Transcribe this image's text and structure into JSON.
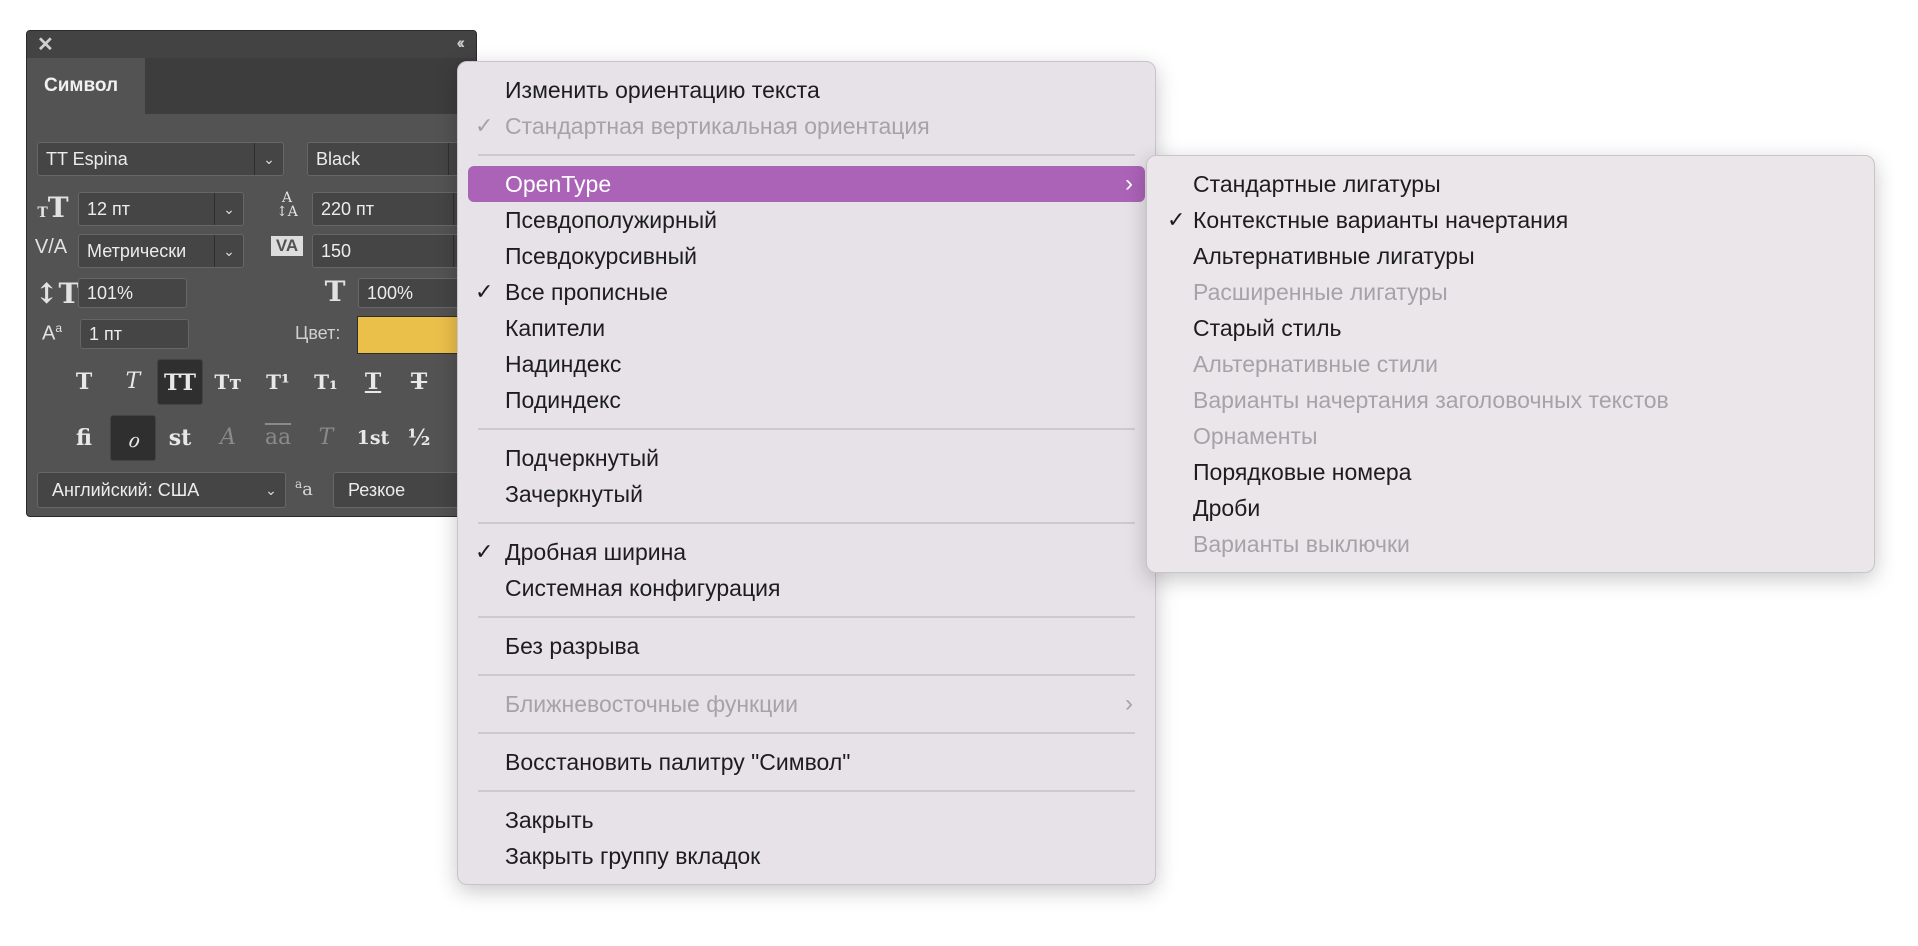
{
  "panel": {
    "title": "Символ",
    "font_family": "TT Espina",
    "font_style": "Black",
    "font_size": "12 пт",
    "leading": "220 пт",
    "kerning": "Метрически",
    "tracking": "150",
    "vertical_scale": "101%",
    "horizontal_scale": "100%",
    "baseline_shift": "1 пт",
    "color_label": "Цвет:",
    "color": "#EBC04A",
    "language": "Английский: США",
    "antialias": "Резкое",
    "style_buttons": [
      {
        "name": "faux-bold",
        "glyph": "T",
        "selected": false
      },
      {
        "name": "faux-italic",
        "glyph": "T",
        "selected": false
      },
      {
        "name": "all-caps",
        "glyph": "TT",
        "selected": true
      },
      {
        "name": "small-caps",
        "glyph": "Tт",
        "selected": false
      },
      {
        "name": "superscript",
        "glyph": "T¹",
        "selected": false
      },
      {
        "name": "subscript",
        "glyph": "T₁",
        "selected": false
      },
      {
        "name": "underline",
        "glyph": "T",
        "selected": false
      },
      {
        "name": "strikethrough",
        "glyph": "T",
        "selected": false
      }
    ],
    "opentype_buttons": [
      {
        "name": "standard-ligatures",
        "glyph": "fi",
        "selected": false,
        "disabled": false
      },
      {
        "name": "contextual-alternates",
        "glyph": "ℴ",
        "selected": true,
        "disabled": false
      },
      {
        "name": "discretionary-ligatures",
        "glyph": "st",
        "selected": false,
        "disabled": false
      },
      {
        "name": "swash",
        "glyph": "A",
        "selected": false,
        "disabled": true
      },
      {
        "name": "stylistic-alternates",
        "glyph": "aa",
        "selected": false,
        "disabled": true
      },
      {
        "name": "titling-alternates",
        "glyph": "T",
        "selected": false,
        "disabled": true
      },
      {
        "name": "ordinals",
        "glyph": "1st",
        "selected": false,
        "disabled": false
      },
      {
        "name": "fractions",
        "glyph": "½",
        "selected": false,
        "disabled": false
      }
    ]
  },
  "menu": {
    "items": [
      {
        "label": "Изменить ориентацию текста"
      },
      {
        "label": "Стандартная вертикальная ориентация",
        "checked": true,
        "disabled": true
      },
      {
        "separator": true
      },
      {
        "label": "OpenType",
        "submenu": true,
        "highlighted": true
      },
      {
        "label": "Псевдополужирный"
      },
      {
        "label": "Псевдокурсивный"
      },
      {
        "label": "Все прописные",
        "checked": true
      },
      {
        "label": "Капители"
      },
      {
        "label": "Надиндекс"
      },
      {
        "label": "Подиндекс"
      },
      {
        "separator": true
      },
      {
        "label": "Подчеркнутый"
      },
      {
        "label": "Зачеркнутый"
      },
      {
        "separator": true
      },
      {
        "label": "Дробная ширина",
        "checked": true
      },
      {
        "label": "Системная конфигурация"
      },
      {
        "separator": true
      },
      {
        "label": "Без разрыва"
      },
      {
        "separator": true
      },
      {
        "label": "Ближневосточные функции",
        "submenu": true,
        "disabled": true
      },
      {
        "separator": true
      },
      {
        "label": "Восстановить палитру \"Символ\""
      },
      {
        "separator": true
      },
      {
        "label": "Закрыть"
      },
      {
        "label": "Закрыть группу вкладок"
      }
    ]
  },
  "submenu": {
    "items": [
      {
        "label": "Стандартные лигатуры"
      },
      {
        "label": "Контекстные варианты начертания",
        "checked": true
      },
      {
        "label": "Альтернативные лигатуры"
      },
      {
        "label": "Расширенные лигатуры",
        "disabled": true
      },
      {
        "label": "Старый стиль"
      },
      {
        "label": "Альтернативные стили",
        "disabled": true
      },
      {
        "label": "Варианты начертания заголовочных текстов",
        "disabled": true
      },
      {
        "label": "Орнаменты",
        "disabled": true
      },
      {
        "label": "Порядковые номера"
      },
      {
        "label": "Дроби"
      },
      {
        "label": "Варианты выключки",
        "disabled": true
      }
    ]
  },
  "colors": {
    "highlight": "#AB63B7",
    "panel_bg": "#535353",
    "menu_bg": "#E6E2E8"
  }
}
